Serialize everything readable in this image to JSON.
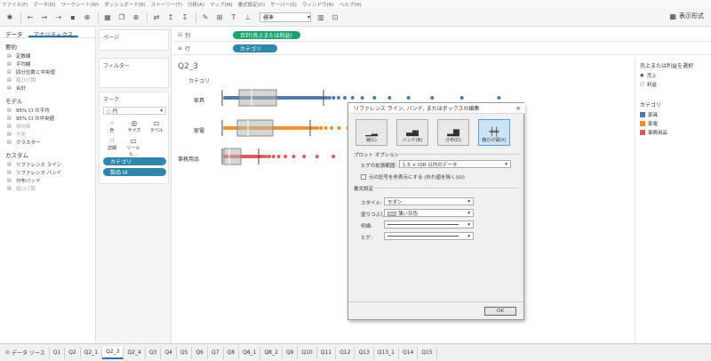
{
  "menu": [
    "ファイル(F)",
    "データ(D)",
    "ワークシート(W)",
    "ダッシュボード(B)",
    "ストーリー(T)",
    "分析(A)",
    "マップ(M)",
    "書式設定(O)",
    "サーバー(S)",
    "ウィンドウ(N)",
    "ヘルプ(H)"
  ],
  "toolbar": {
    "mark_type": "標準",
    "show_me": "表示形式"
  },
  "left_panel": {
    "tab_data": "データ",
    "tab_analytics": "アナリティクス",
    "summary_title": "要約",
    "summary_items": [
      "定数線",
      "平均線",
      "四分位数と中央値",
      "箱ひげ図",
      "合計"
    ],
    "model_title": "モデル",
    "model_items": [
      "95% CI の平均",
      "95% CI の中央値",
      "傾向線",
      "予測",
      "クラスター"
    ],
    "custom_title": "カスタム",
    "custom_items": [
      "リファレンス ライン",
      "リファレンス バンド",
      "分布バンド",
      "箱ひげ図"
    ]
  },
  "pages_col": {
    "pages": "ページ",
    "filters": "フィルター",
    "marks": "マーク",
    "mark_type": "円",
    "btn_color": "色",
    "btn_size": "サイズ",
    "btn_label": "ラベル",
    "btn_detail": "詳細",
    "btn_tooltip": "ツールヒ…",
    "pill_category": "カテゴリ",
    "pill_product": "製品 Id"
  },
  "shelves": {
    "cols_label": "列",
    "rows_label": "行",
    "cols_pill": "合計(売上または利益)",
    "rows_pill": "カテゴリ"
  },
  "viz": {
    "title": "Q2_3",
    "header": "カテゴリ",
    "categories": [
      "家具",
      "家電",
      "事務用品"
    ]
  },
  "right_panel": {
    "param_title": "売上または利益を選択",
    "param_options": [
      "売上",
      "利益"
    ],
    "legend_title": "カテゴリ",
    "legend_items": [
      {
        "label": "家具",
        "color": "#4e79a7"
      },
      {
        "label": "家電",
        "color": "#f28e2b"
      },
      {
        "label": "事務用品",
        "color": "#e15759"
      }
    ]
  },
  "dialog": {
    "title": "リファレンス ライン, バンド, またはボックスの編集",
    "types": [
      "線(L)",
      "バンド(B)",
      "分布(D)",
      "箱ひげ図(X)"
    ],
    "plot_options": "プロット オプション",
    "whisker_label": "ヒゲの拡張範囲:",
    "whisker_value": "1.5 × IQR 以内のデータ",
    "hide_marks": "元の記号を非表示にする (外れ値を除く)(U)",
    "format_title": "書式設定",
    "style_label": "スタイル:",
    "style_value": "モダン",
    "fill_label": "塗りつぶし:",
    "fill_value": "薄い灰色",
    "border_label": "枠線:",
    "whisker_fmt_label": "ヒゲ:",
    "ok": "OK"
  },
  "bottom": {
    "datasource": "データ ソース",
    "tabs": [
      "Q1",
      "Q2",
      "Q2_1",
      "Q2_3",
      "Q2_4",
      "Q3",
      "Q4",
      "Q5",
      "Q6",
      "Q7",
      "Q8",
      "Q8_1",
      "Q8_2",
      "Q9",
      "Q10",
      "Q11",
      "Q12",
      "Q13",
      "Q13_1",
      "Q14",
      "Q15"
    ],
    "active": "Q2_3"
  }
}
